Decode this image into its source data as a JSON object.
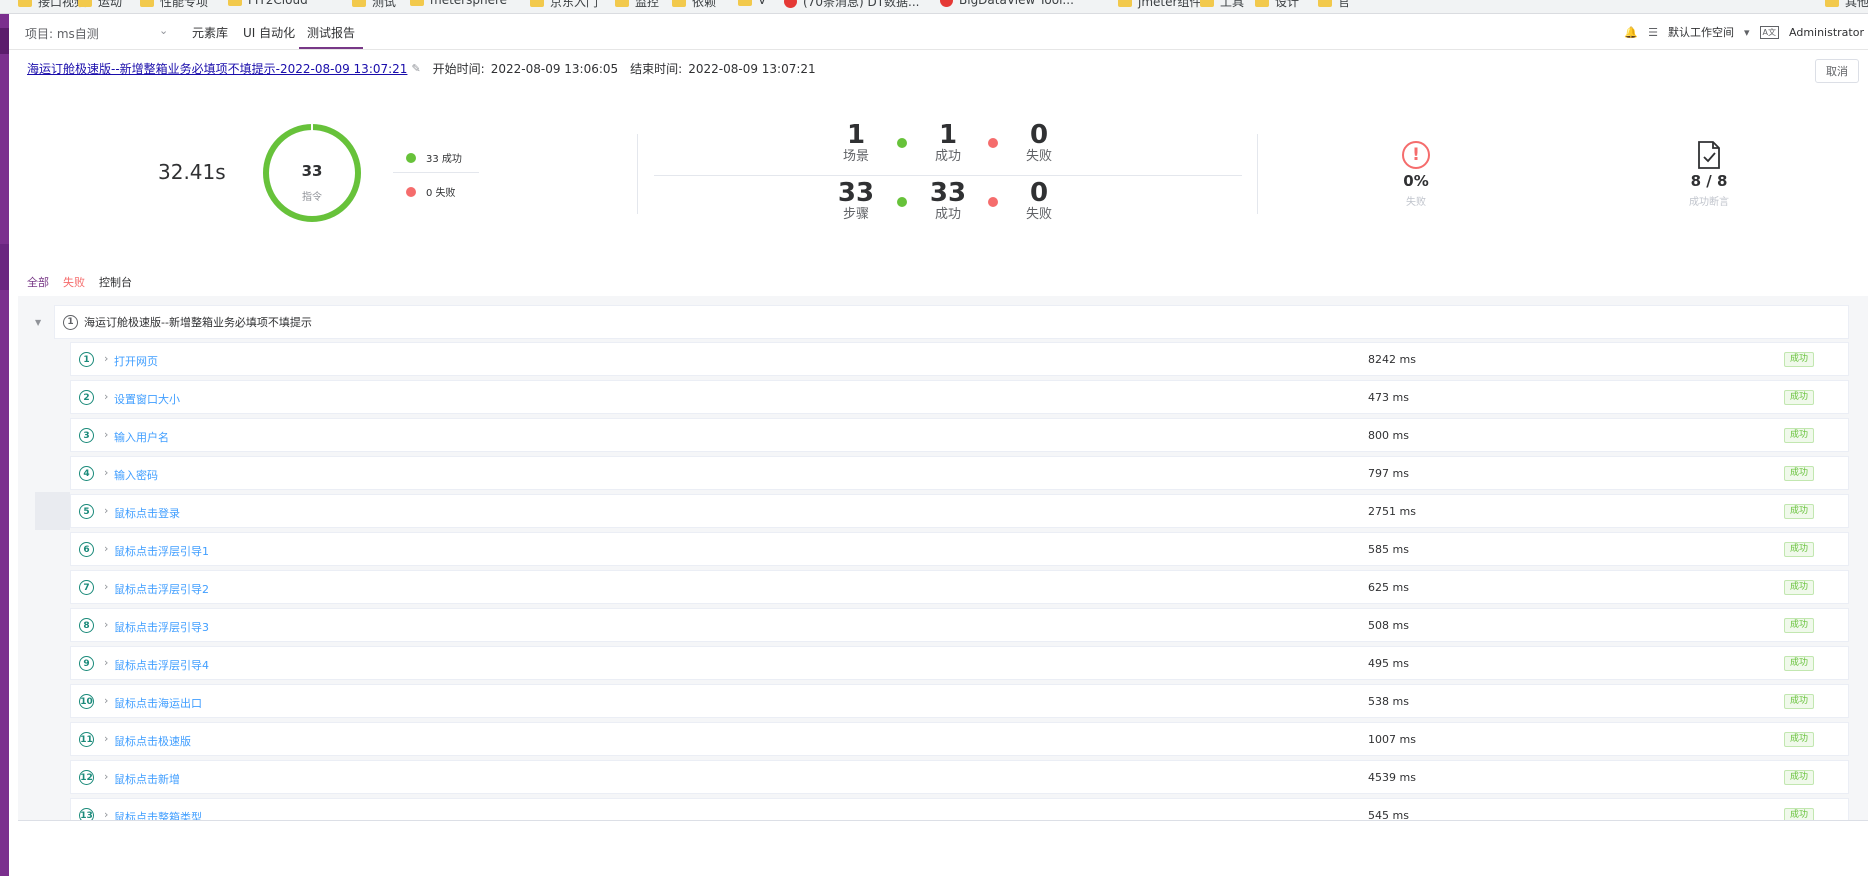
{
  "bookmarks": [
    {
      "label": "接口视频",
      "type": "folder"
    },
    {
      "label": "运动",
      "type": "folder"
    },
    {
      "label": "性能专项",
      "type": "folder"
    },
    {
      "label": "FIT2Cloud",
      "type": "folder"
    },
    {
      "label": "测试",
      "type": "folder"
    },
    {
      "label": "metersphere",
      "type": "folder"
    },
    {
      "label": "京东入门",
      "type": "folder"
    },
    {
      "label": "监控",
      "type": "folder"
    },
    {
      "label": "依赖",
      "type": "folder"
    },
    {
      "label": "V",
      "type": "folder"
    },
    {
      "label": "(70条消息) DT数据...",
      "type": "page"
    },
    {
      "label": "BigDataView Tool...",
      "type": "page"
    },
    {
      "label": "jmeter组件",
      "type": "folder"
    },
    {
      "label": "工具",
      "type": "folder"
    },
    {
      "label": "设计",
      "type": "folder"
    },
    {
      "label": "官",
      "type": "folder"
    },
    {
      "label": "其他",
      "type": "folder"
    }
  ],
  "topnav": {
    "project": "项目: ms自测",
    "items": [
      "元素库",
      "UI 自动化",
      "测试报告"
    ],
    "active": "测试报告",
    "workspace": "默认工作空间",
    "user": "Administrator"
  },
  "report": {
    "title": "海运订舱极速版--新增整箱业务必填项不填提示-2022-08-09 13:07:21",
    "start_label": "开始时间:",
    "start_time": "2022-08-09 13:06:05",
    "end_label": "结束时间:",
    "end_time": "2022-08-09 13:07:21",
    "cancel": "取消"
  },
  "summary": {
    "duration": "32.41s",
    "donut": {
      "total": "33",
      "label": "指令",
      "success_fraction": 1.0
    },
    "legend": [
      {
        "label": "33 成功",
        "color": "#67c23a"
      },
      {
        "label": "0 失败",
        "color": "#f56c6c"
      }
    ],
    "scenario": {
      "count": "1",
      "count_label": "场景",
      "success": "1",
      "success_label": "成功",
      "fail": "0",
      "fail_label": "失败"
    },
    "steps": {
      "count": "33",
      "count_label": "步骤",
      "success": "33",
      "success_label": "成功",
      "fail": "0",
      "fail_label": "失败"
    },
    "fail_rate": {
      "value": "0%",
      "label": "失败",
      "icon": "exclamation-circle-icon"
    },
    "assertions": {
      "value": "8 / 8",
      "label": "成功断言",
      "icon": "document-check-icon"
    }
  },
  "tabs": [
    "全部",
    "失败",
    "控制台"
  ],
  "tree": {
    "scenario": {
      "index": "1",
      "title": "海运订舱极速版--新增整箱业务必填项不填提示"
    },
    "steps": [
      {
        "index": "1",
        "name": "打开网页",
        "time": "8242 ms",
        "status": "成功"
      },
      {
        "index": "2",
        "name": "设置窗口大小",
        "time": "473 ms",
        "status": "成功"
      },
      {
        "index": "3",
        "name": "输入用户名",
        "time": "800 ms",
        "status": "成功"
      },
      {
        "index": "4",
        "name": "输入密码",
        "time": "797 ms",
        "status": "成功"
      },
      {
        "index": "5",
        "name": "鼠标点击登录",
        "time": "2751 ms",
        "status": "成功"
      },
      {
        "index": "6",
        "name": "鼠标点击浮层引导1",
        "time": "585 ms",
        "status": "成功"
      },
      {
        "index": "7",
        "name": "鼠标点击浮层引导2",
        "time": "625 ms",
        "status": "成功"
      },
      {
        "index": "8",
        "name": "鼠标点击浮层引导3",
        "time": "508 ms",
        "status": "成功"
      },
      {
        "index": "9",
        "name": "鼠标点击浮层引导4",
        "time": "495 ms",
        "status": "成功"
      },
      {
        "index": "10",
        "name": "鼠标点击海运出口",
        "time": "538 ms",
        "status": "成功"
      },
      {
        "index": "11",
        "name": "鼠标点击极速版",
        "time": "1007 ms",
        "status": "成功"
      },
      {
        "index": "12",
        "name": "鼠标点击新增",
        "time": "4539 ms",
        "status": "成功"
      },
      {
        "index": "13",
        "name": "鼠标点击整箱类型",
        "time": "545 ms",
        "status": "成功"
      }
    ]
  }
}
